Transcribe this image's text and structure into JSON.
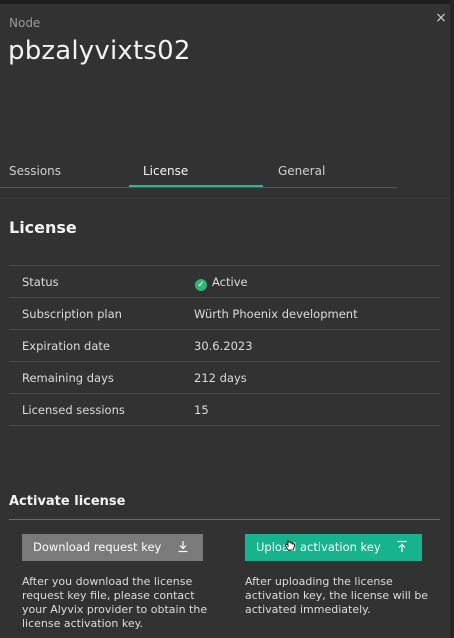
{
  "node_label": "Node",
  "node_title": "pbzalyvixts02",
  "close_icon": "×",
  "tabs": [
    {
      "label": "Sessions"
    },
    {
      "label": "License",
      "active": true
    },
    {
      "label": "General"
    }
  ],
  "license": {
    "heading": "License",
    "rows": [
      {
        "key": "Status",
        "value": "Active"
      },
      {
        "key": "Subscription plan",
        "value": "Würth Phoenix development"
      },
      {
        "key": "Expiration date",
        "value": "30.6.2023"
      },
      {
        "key": "Remaining days",
        "value": "212 days"
      },
      {
        "key": "Licensed sessions",
        "value": "15"
      }
    ],
    "status_icon": "check-circle-icon",
    "status_color": "#2bb673"
  },
  "activate": {
    "heading": "Activate license",
    "download_button": "Download request key",
    "download_icon": "download-icon",
    "upload_button": "Upload activation key",
    "upload_icon": "upload-icon",
    "download_desc": "After you download the license request key file, please contact your Alyvix provider to obtain the license activation key.",
    "upload_desc": "After uploading the license activation key, the license will be activated immediately."
  },
  "colors": {
    "accent": "#29b896",
    "upload_button": "#17b38c",
    "download_button": "#7a7a7a"
  }
}
